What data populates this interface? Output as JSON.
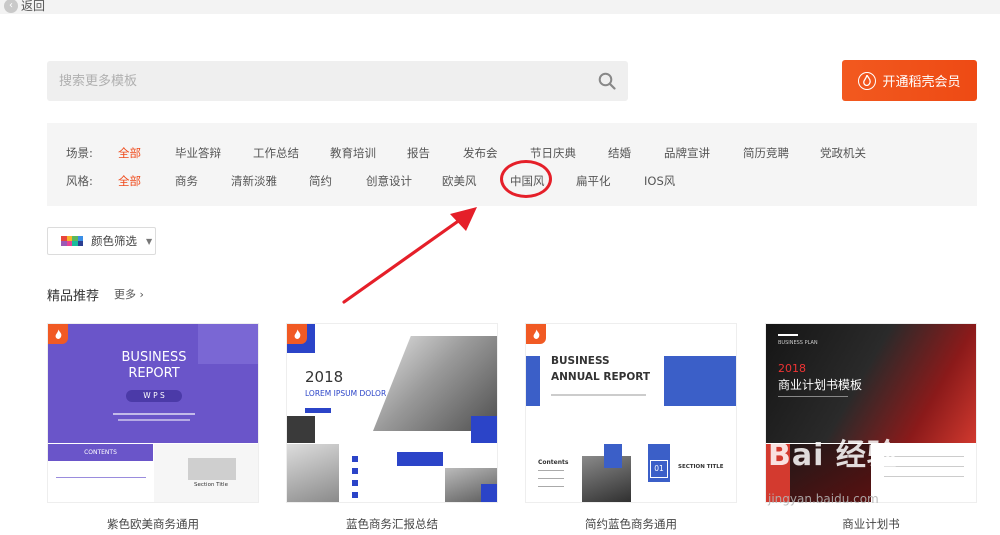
{
  "back": {
    "label": "返回"
  },
  "search": {
    "placeholder": "搜索更多模板"
  },
  "vip": {
    "label": "开通稻壳会员"
  },
  "filters": {
    "scene": {
      "label": "场景:",
      "items": [
        "全部",
        "毕业答辩",
        "工作总结",
        "教育培训",
        "报告",
        "发布会",
        "节日庆典",
        "结婚",
        "品牌宣讲",
        "简历竞聘",
        "党政机关"
      ]
    },
    "style": {
      "label": "风格:",
      "items": [
        "全部",
        "商务",
        "清新淡雅",
        "简约",
        "创意设计",
        "欧美风",
        "中国风",
        "扁平化",
        "IOS风"
      ]
    }
  },
  "color_filter": {
    "label": "颜色筛选"
  },
  "section": {
    "title": "精品推荐",
    "more": "更多"
  },
  "cards": [
    {
      "title": "紫色欧美商务通用",
      "main": "BUSINESS",
      "main2": "REPORT",
      "tag": "W P S",
      "contents": "CONTENTS",
      "section": "Section Title"
    },
    {
      "title": "蓝色商务汇报总结",
      "year": "2018",
      "headline": "LOREM IPSUM DOLOR"
    },
    {
      "title": "简约蓝色商务通用",
      "main": "BUSINESS",
      "main2": "ANNUAL REPORT",
      "contents": "Contents",
      "num": "01",
      "section": "SECTION TITLE"
    },
    {
      "title": "商业计划书",
      "year": "2018",
      "headline": "商业计划书模板",
      "sub": "BUSINESS PLAN"
    }
  ],
  "watermark": {
    "brand": "Bai 经验",
    "url": "jingyan.baidu.com"
  },
  "colors": {
    "accent": "#ef4a1a",
    "annotation": "#e51f29",
    "purple": "#6a55c9",
    "blue": "#2b44c8"
  }
}
